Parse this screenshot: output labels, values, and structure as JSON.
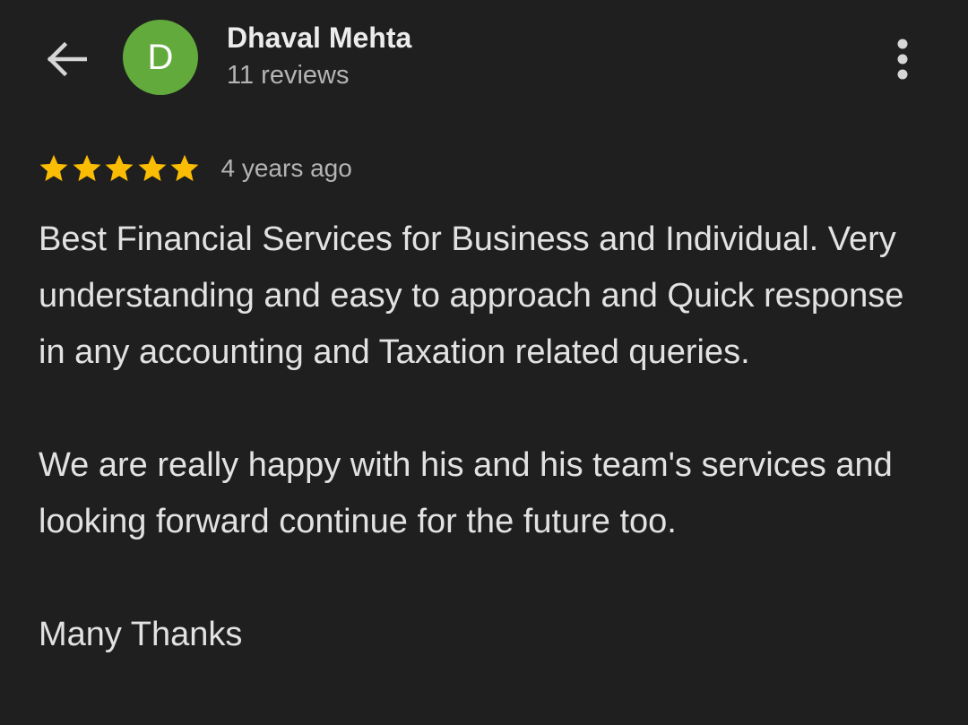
{
  "header": {
    "back_icon": "arrow-left-icon",
    "avatar_initial": "D",
    "avatar_color": "#62aa3c",
    "user_name": "Dhaval Mehta",
    "review_count": "11 reviews",
    "more_icon": "more-vertical-icon"
  },
  "review": {
    "rating": 5,
    "rating_max": 5,
    "star_color": "#fbbc04",
    "time_ago": "4 years ago",
    "paragraphs": [
      "Best Financial Services for Business and Individual. Very understanding and easy to approach and Quick response in any accounting and Taxation related queries.",
      "We are really happy with his and his team's services and looking forward continue for the future too.",
      "Many Thanks"
    ]
  },
  "colors": {
    "background": "#1f1f1f",
    "primary_text": "#e2e2e2",
    "secondary_text": "#b4b4b4"
  }
}
